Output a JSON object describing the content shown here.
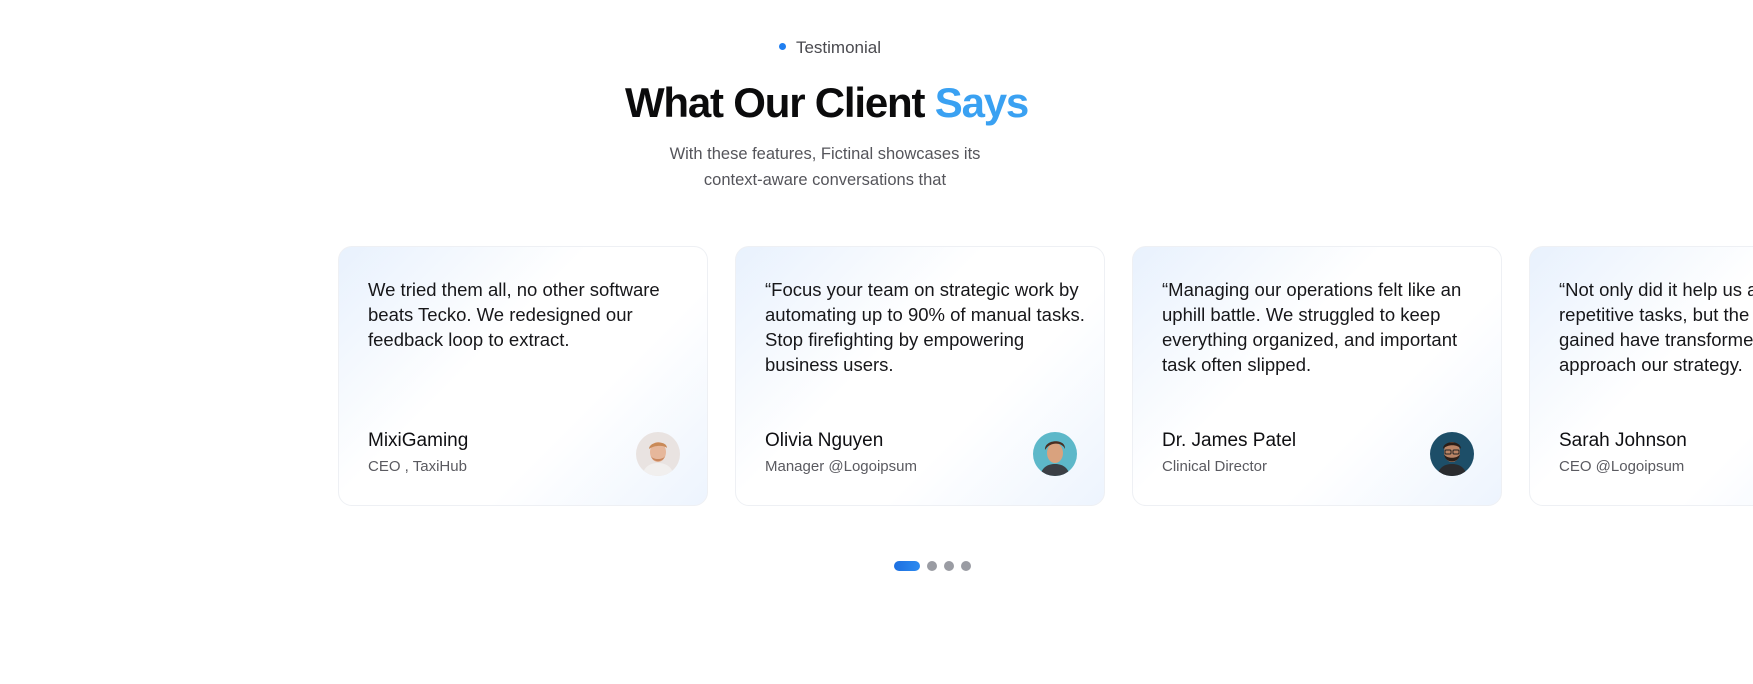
{
  "header": {
    "eyebrow": "Testimonial",
    "title_main": "What Our Client ",
    "title_accent": "Says",
    "subtitle_line1": "With these features, Fictinal showcases its",
    "subtitle_line2": "context-aware conversations that"
  },
  "testimonials": [
    {
      "quote": "We tried them all, no other software beats Tecko. We redesigned our feedback loop to extract.",
      "name": "MixiGaming",
      "role": "CEO , TaxiHub",
      "avatar": "person-avatar-blond"
    },
    {
      "quote": "“Focus your team on strategic work by automating up to 90% of manual tasks. Stop firefighting by empowering business users.",
      "name": "Olivia Nguyen",
      "role": "Manager @Logoipsum",
      "avatar": "person-avatar-teal"
    },
    {
      "quote": "“Managing our operations felt like an uphill battle. We struggled to keep everything organized, and important task often slipped.",
      "name": "Dr. James Patel",
      "role": "Clinical Director",
      "avatar": "person-avatar-dark"
    },
    {
      "quote": "“Not only did it help us automate repetitive tasks, but the insights we gained have transformed how we approach our strategy.",
      "name": "Sarah Johnson",
      "role": "CEO @Logoipsum",
      "avatar": "person-avatar-none"
    }
  ],
  "pagination": {
    "total": 4,
    "active": 1
  },
  "colors": {
    "accent": "#3aa1f2",
    "dot_active": "#1d6fe0",
    "dot_inactive": "#9a9ca3"
  }
}
